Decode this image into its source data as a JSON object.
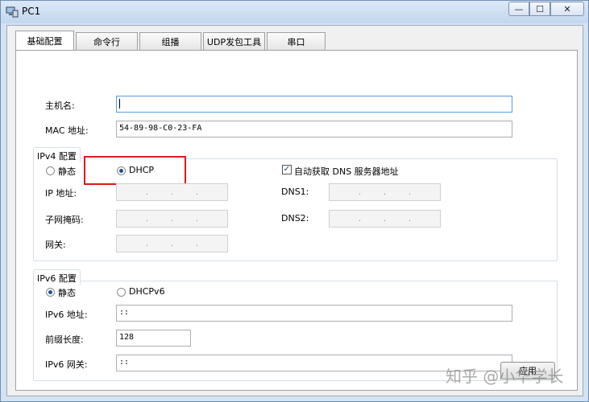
{
  "window": {
    "title": "PC1",
    "minimize_glyph": "—",
    "maximize_glyph": "☐",
    "close_glyph": "✕"
  },
  "tabs": [
    {
      "label": "基础配置",
      "active": true
    },
    {
      "label": "命令行",
      "active": false
    },
    {
      "label": "组播",
      "active": false
    },
    {
      "label": "UDP发包工具",
      "active": false
    },
    {
      "label": "串口",
      "active": false
    }
  ],
  "basic": {
    "hostname_label": "主机名:",
    "hostname_value": "",
    "mac_label": "MAC 地址:",
    "mac_value": "54-89-98-C0-23-FA"
  },
  "ipv4": {
    "group_title": "IPv4 配置",
    "static_label": "静态",
    "dhcp_label": "DHCP",
    "auto_dns_label": "自动获取 DNS 服务器地址",
    "ip_label": "IP 地址:",
    "mask_label": "子网掩码:",
    "gateway_label": "网关:",
    "dns1_label": "DNS1:",
    "dns2_label": "DNS2:",
    "ip_dot": "."
  },
  "ipv6": {
    "group_title": "IPv6 配置",
    "static_label": "静态",
    "dhcpv6_label": "DHCPv6",
    "addr_label": "IPv6 地址:",
    "addr_value": "::",
    "prefix_label": "前缀长度:",
    "prefix_value": "128",
    "gateway_label": "IPv6 网关:",
    "gateway_value": "::"
  },
  "apply_button_label": "应用",
  "watermark": "知乎 @小华学长",
  "colors": {
    "highlight": "#e0191c",
    "title_bar": "#c3d7ee"
  }
}
